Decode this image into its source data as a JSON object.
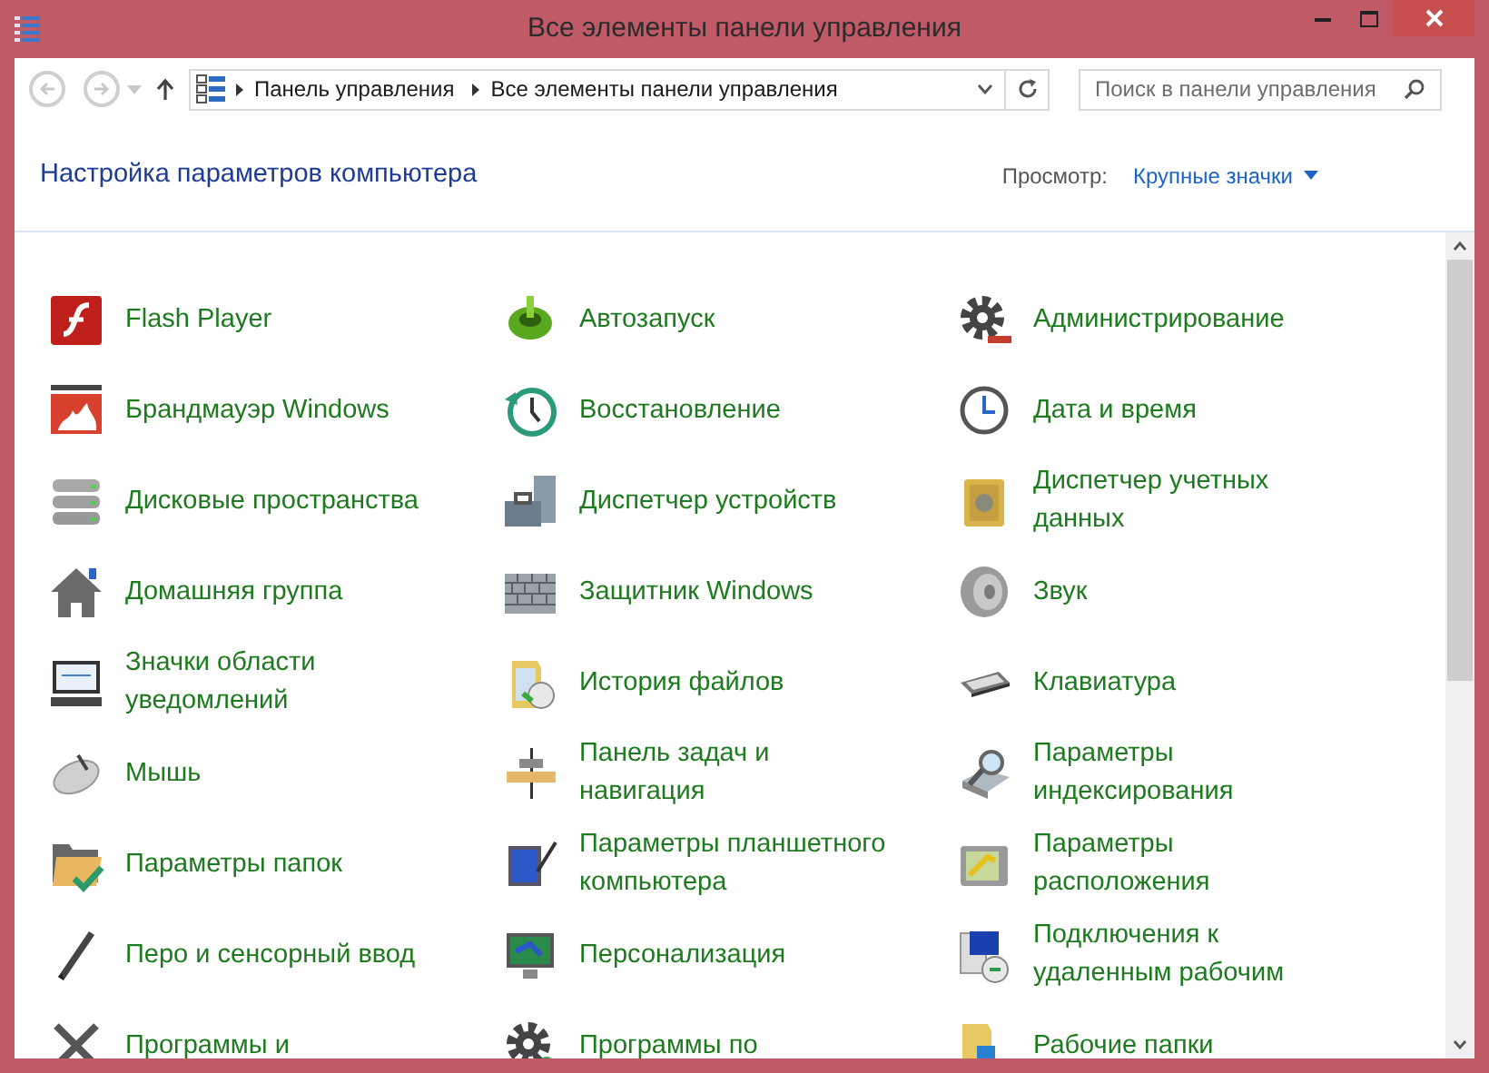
{
  "window": {
    "title": "Все элементы панели управления"
  },
  "nav": {
    "back_disabled": true,
    "forward_disabled": true
  },
  "address_bar": {
    "breadcrumbs": [
      "Панель управления",
      "Все элементы панели управления"
    ]
  },
  "search": {
    "placeholder": "Поиск в панели управления"
  },
  "heading": "Настройка параметров компьютера",
  "view": {
    "label": "Просмотр:",
    "value": "Крупные значки"
  },
  "items": [
    {
      "label": "Flash Player"
    },
    {
      "label": "Автозапуск"
    },
    {
      "label": "Администрирование"
    },
    {
      "label": "Брандмауэр Windows"
    },
    {
      "label": "Восстановление"
    },
    {
      "label": "Дата и время"
    },
    {
      "label": "Дисковые пространства"
    },
    {
      "label": "Диспетчер устройств"
    },
    {
      "label": "Диспетчер учетных\nданных"
    },
    {
      "label": "Домашняя группа"
    },
    {
      "label": "Защитник Windows"
    },
    {
      "label": "Звук"
    },
    {
      "label": "Значки области\nуведомлений"
    },
    {
      "label": "История файлов"
    },
    {
      "label": "Клавиатура"
    },
    {
      "label": "Мышь"
    },
    {
      "label": "Панель задач и\nнавигация"
    },
    {
      "label": "Параметры\nиндексирования"
    },
    {
      "label": "Параметры папок"
    },
    {
      "label": "Параметры планшетного\nкомпьютера"
    },
    {
      "label": "Параметры\nрасположения"
    },
    {
      "label": "Перо и сенсорный ввод"
    },
    {
      "label": "Персонализация"
    },
    {
      "label": "Подключения к\nудаленным рабочим"
    },
    {
      "label": "Программы и"
    },
    {
      "label": "Программы по"
    },
    {
      "label": "Рабочие папки"
    }
  ]
}
